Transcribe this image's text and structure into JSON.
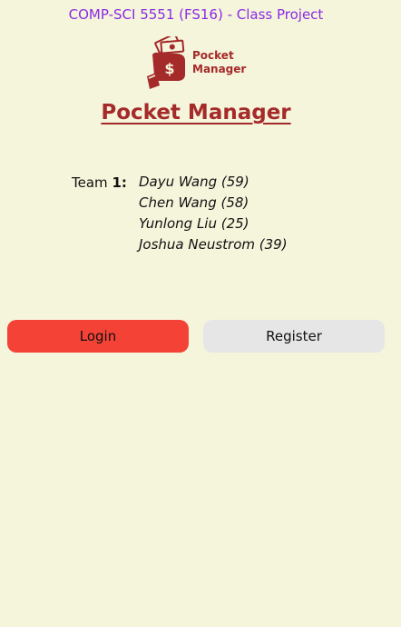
{
  "header": {
    "course": "COMP-SCI 5551 (FS16) - Class Project"
  },
  "logo": {
    "line1": "Pocket",
    "line2": "Manager",
    "icon": "money-hand-icon"
  },
  "app": {
    "title": "Pocket Manager"
  },
  "team": {
    "label": "Team",
    "number": "1:",
    "members": [
      "Dayu Wang (59)",
      "Chen Wang (58)",
      "Yunlong Liu (25)",
      "Joshua Neustrom (39)"
    ]
  },
  "actions": {
    "login_label": "Login",
    "register_label": "Register"
  },
  "colors": {
    "background": "#f5f5dc",
    "course_text": "#8a2be2",
    "brand": "#a52a2a",
    "login_button": "#f44336",
    "register_button": "#e6e6e6"
  }
}
